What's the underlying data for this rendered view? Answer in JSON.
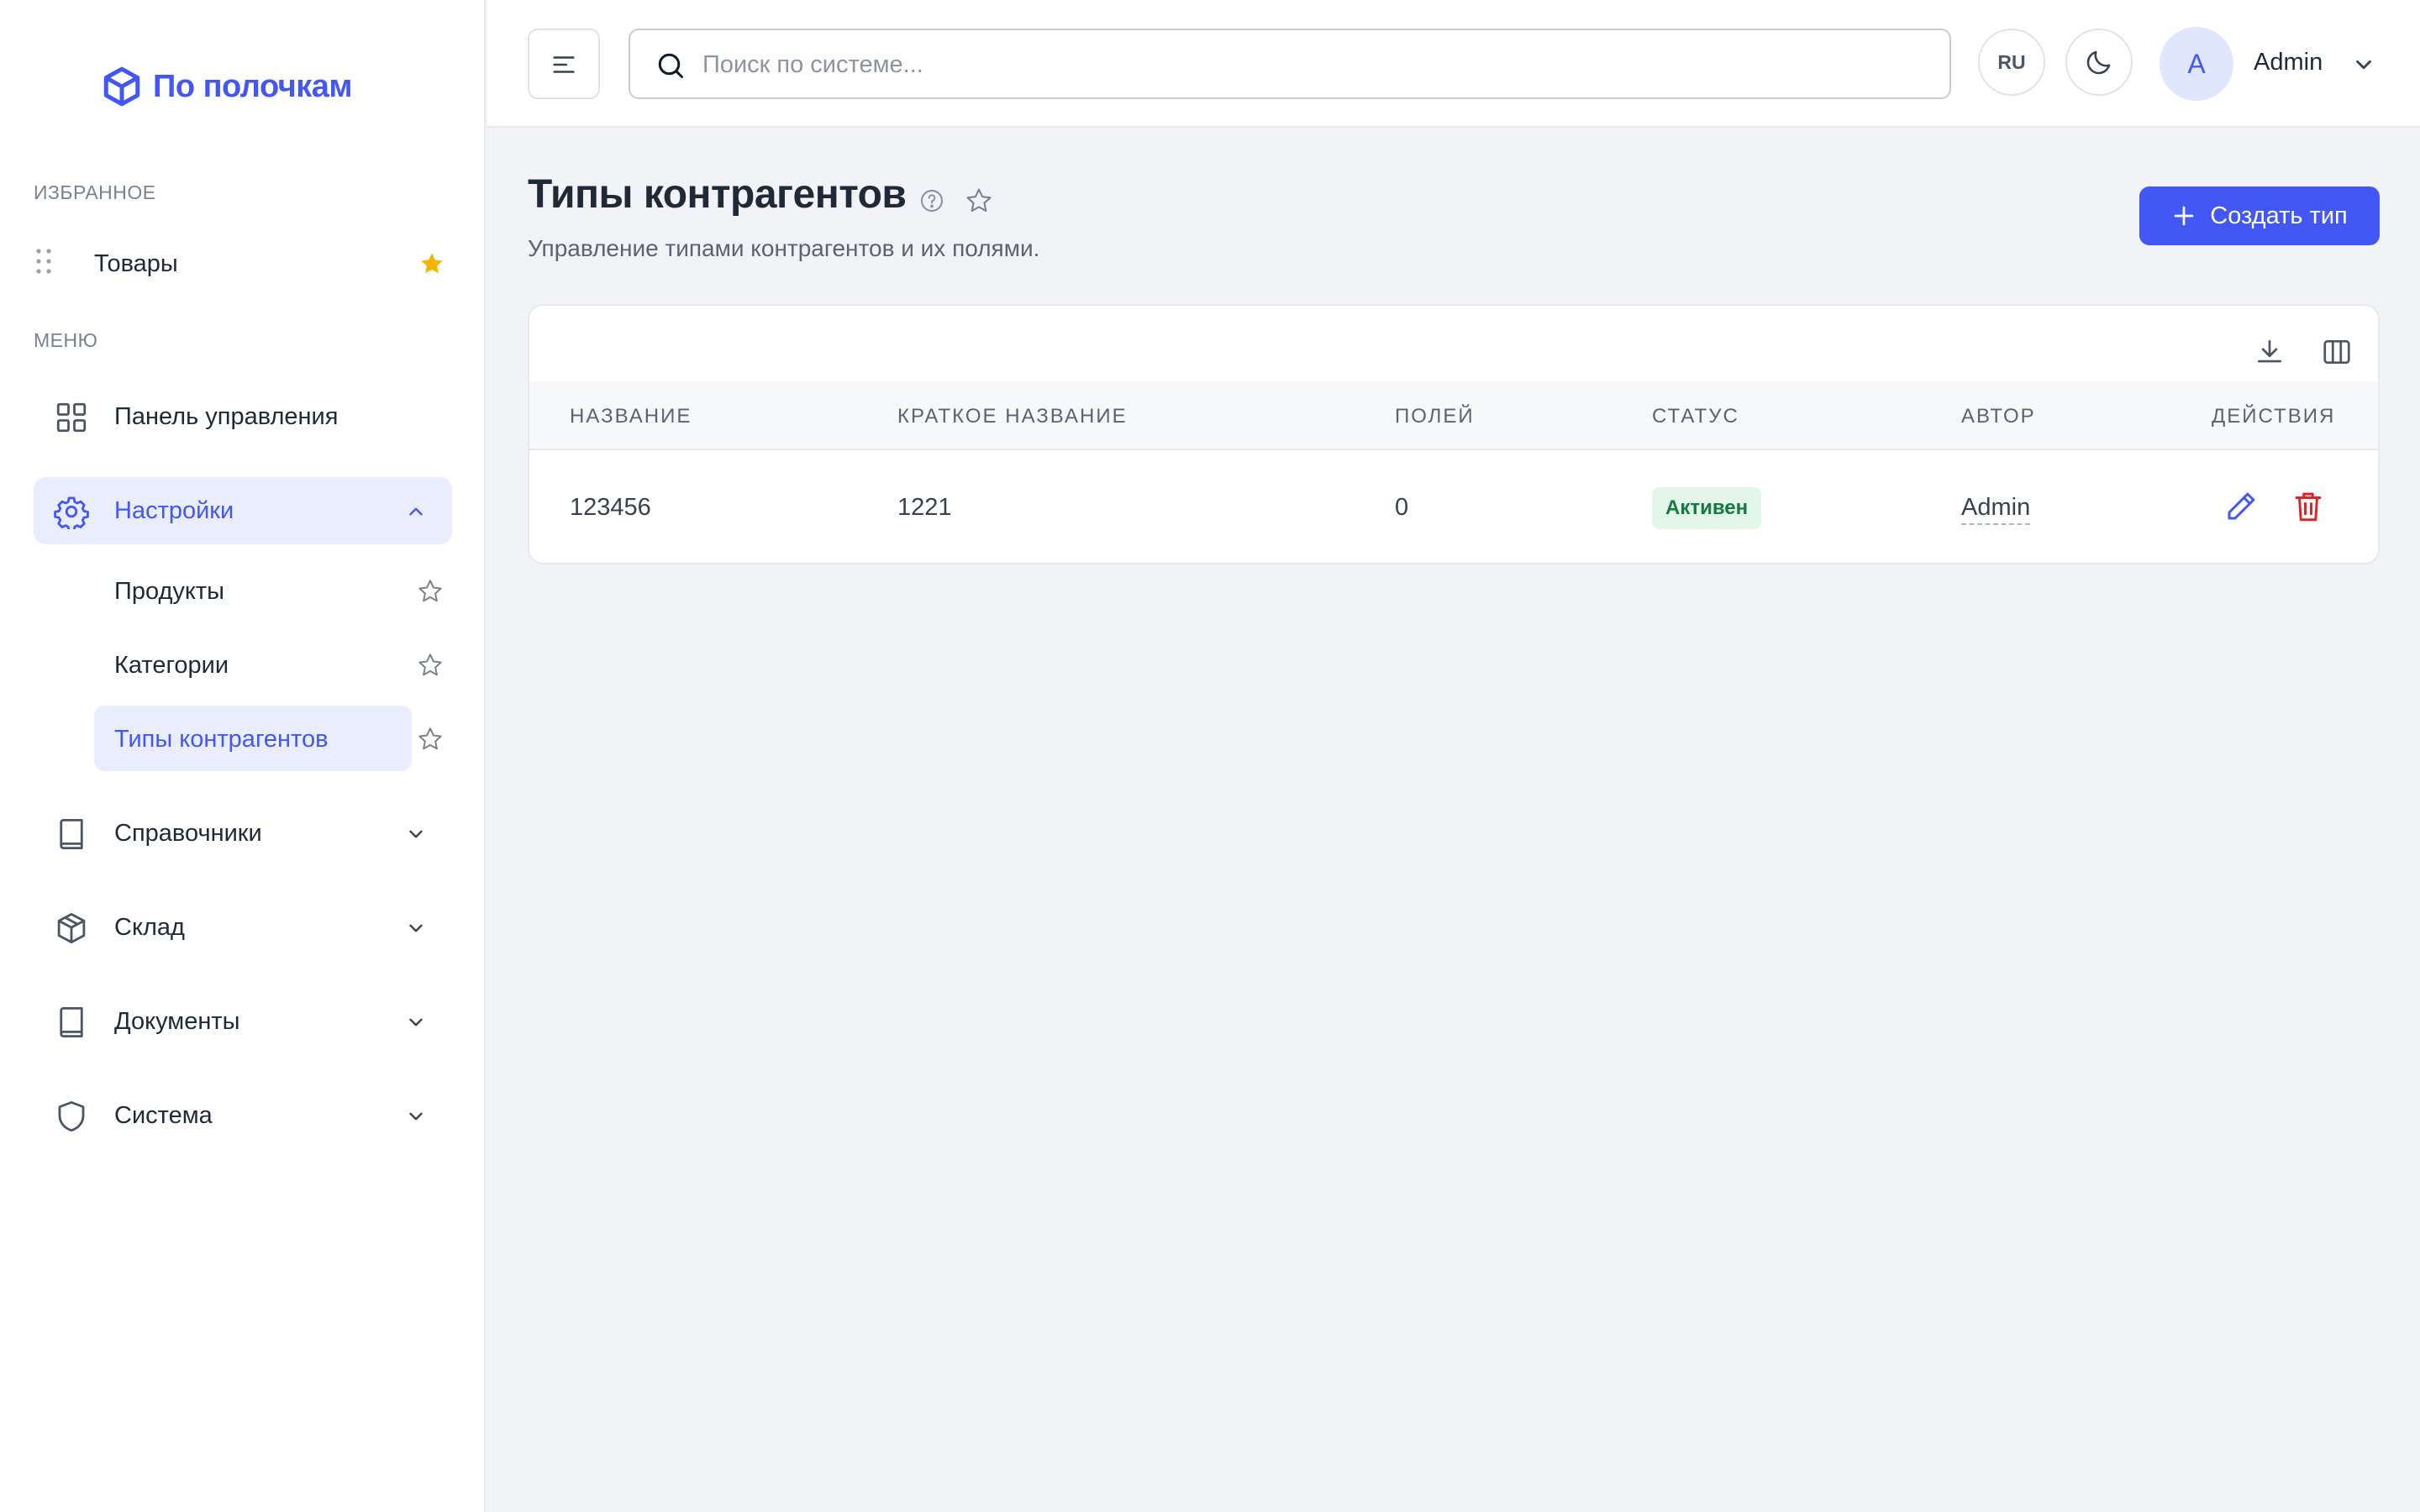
{
  "brand": {
    "name": "По полочкам",
    "color": "#4257f5"
  },
  "sidebar": {
    "favorites_label": "ИЗБРАННОЕ",
    "favorites": [
      {
        "label": "Товары",
        "icon": "star-filled-icon"
      }
    ],
    "menu_label": "МЕНЮ",
    "items": [
      {
        "label": "Панель управления",
        "icon": "dashboard-icon"
      },
      {
        "label": "Настройки",
        "icon": "gear-icon",
        "expanded": true,
        "children": [
          {
            "label": "Продукты"
          },
          {
            "label": "Категории"
          },
          {
            "label": "Типы контрагентов",
            "active": true
          }
        ]
      },
      {
        "label": "Справочники",
        "icon": "book-icon"
      },
      {
        "label": "Склад",
        "icon": "box-icon"
      },
      {
        "label": "Документы",
        "icon": "book-icon"
      },
      {
        "label": "Система",
        "icon": "shield-icon"
      }
    ]
  },
  "topbar": {
    "search_placeholder": "Поиск по системе...",
    "lang": "RU",
    "user": {
      "initial": "A",
      "name": "Admin"
    }
  },
  "page": {
    "title": "Типы контрагентов",
    "subtitle": "Управление типами контрагентов и их полями.",
    "create_label": "Создать тип"
  },
  "table": {
    "columns": [
      "НАЗВАНИЕ",
      "КРАТКОЕ НАЗВАНИЕ",
      "ПОЛЕЙ",
      "СТАТУС",
      "АВТОР",
      "ДЕЙСТВИЯ"
    ],
    "rows": [
      {
        "name": "123456",
        "short": "1221",
        "fields": "0",
        "status": "Активен",
        "author": "Admin"
      }
    ]
  },
  "colors": {
    "accent": "#4257f5",
    "active_bg": "#e9edfd",
    "star": "#f2b600",
    "danger": "#e02424",
    "success_bg": "#e4f6ea",
    "success_text": "#157a42"
  }
}
